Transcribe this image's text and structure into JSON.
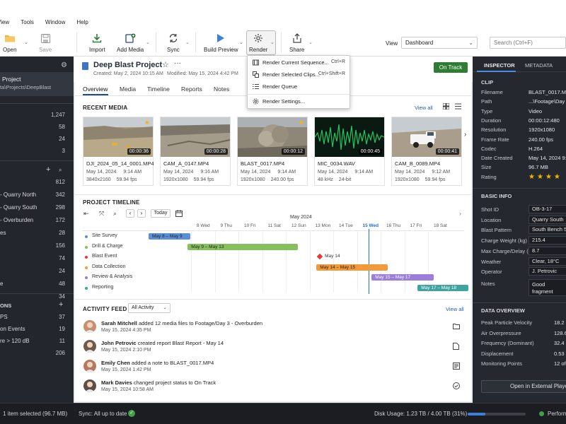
{
  "menu": [
    "View",
    "Tools",
    "Window",
    "Help"
  ],
  "toolbar": {
    "open": "Open",
    "save": "Save",
    "import": "Import",
    "add_media": "Add Media",
    "sync": "Sync",
    "build_preview": "Build Preview",
    "render": "Render",
    "share": "Share",
    "view_label": "View",
    "view_value": "Dashboard",
    "search_placeholder": "Search (Ctrl+F)"
  },
  "render_menu": [
    {
      "label": "Render Current Sequence...",
      "shortcut": "Ctrl+R",
      "icon": "film-icon"
    },
    {
      "label": "Render Selected Clips...",
      "shortcut": "Ctrl+Shift+R",
      "icon": "clips-icon"
    },
    {
      "label": "Render Queue",
      "shortcut": "",
      "icon": "list-icon"
    },
    {
      "label": "Render Settings...",
      "shortcut": "",
      "icon": "gear-icon"
    }
  ],
  "sidebar": {
    "project_name": "Project",
    "project_path": "ta\\Projects\\DeepBlast",
    "counts_top": [
      "1,247",
      "58",
      "24",
      "3"
    ],
    "tags": [
      {
        "label": "",
        "count": "812"
      },
      {
        "label": "- Quarry North",
        "count": "342"
      },
      {
        "label": "- Quarry South",
        "count": "298"
      },
      {
        "label": "- Overburden",
        "count": "172"
      },
      {
        "label": "es",
        "count": "28"
      },
      {
        "label": "",
        "count": "156"
      },
      {
        "label": "",
        "count": "74"
      },
      {
        "label": "",
        "count": "24"
      },
      {
        "label": "e",
        "count": "48"
      },
      {
        "label": "",
        "count": "34"
      }
    ],
    "conditions_title": "ONS",
    "conditions": [
      {
        "label": "PS",
        "count": "37"
      },
      {
        "label": "on Events",
        "count": "19"
      },
      {
        "label": "re > 120 dB",
        "count": "11"
      },
      {
        "label": "",
        "count": "206"
      }
    ]
  },
  "project": {
    "title": "Deep Blast Project",
    "created": "Created: May 2, 2024 10:15 AM",
    "modified": "Modified: May 15, 2024 4:42 PM",
    "status": "On Track"
  },
  "tabs": [
    "Overview",
    "Media",
    "Timeline",
    "Reports",
    "Notes"
  ],
  "recent_media": {
    "title": "RECENT MEDIA",
    "view_all": "View all",
    "items": [
      {
        "name": "DJI_2024_05_14_0001.MP4",
        "date": "May 14, 2024",
        "time": "9:14 AM",
        "res": "3840x2160",
        "fps": "59.94 fps",
        "duration": "00:00:36",
        "starred": true,
        "kind": "quarry"
      },
      {
        "name": "CAM_A_0147.MP4",
        "date": "May 14, 2024",
        "time": "9:16 AM",
        "res": "1920x1080",
        "fps": "59.94 fps",
        "duration": "00:00:28",
        "starred": false,
        "kind": "quarry2"
      },
      {
        "name": "BLAST_0017.MP4",
        "date": "May 14, 2024",
        "time": "9:14 AM",
        "res": "1920x1080",
        "fps": "240.00 fps",
        "duration": "00:00:12",
        "starred": true,
        "kind": "blast"
      },
      {
        "name": "MIC_0034.WAV",
        "date": "May 14, 2024",
        "time": "9:14 AM",
        "res": "48 kHz",
        "fps": "24-bit",
        "duration": "00:00:45",
        "starred": false,
        "kind": "audio"
      },
      {
        "name": "CAM_B_0089.MP4",
        "date": "May 14, 2024",
        "time": "9:12 AM",
        "res": "1920x1080",
        "fps": "59.94 fps",
        "duration": "00:00:41",
        "starred": false,
        "kind": "truck"
      }
    ]
  },
  "timeline": {
    "title": "PROJECT TIMELINE",
    "today": "Today",
    "month": "May 2024",
    "days": [
      "8 Wed",
      "9 Thu",
      "10 Fri",
      "11 Sat",
      "12 Sun",
      "13 Mon",
      "14 Tue",
      "15 Wed",
      "16 Thu",
      "17 Fri",
      "18 Sat"
    ],
    "today_index": 7,
    "tracks": [
      {
        "name": "Site Survey",
        "color": "#5b8fd4",
        "label": "May 8 – May 9",
        "start": 0,
        "end": 1.8
      },
      {
        "name": "Drill & Charge",
        "color": "#86bf5e",
        "label": "May 9 – May 13",
        "start": 1.7,
        "end": 6.5
      },
      {
        "name": "Blast Event",
        "color": "#e53935",
        "label": "May 14",
        "start": 7.45,
        "end": 7.45,
        "milestone": true
      },
      {
        "name": "Data Collection",
        "color": "#f29a3a",
        "label": "May 14 – May 15",
        "start": 7.3,
        "end": 10.4
      },
      {
        "name": "Review & Analysis",
        "color": "#9b7ddc",
        "label": "May 15 – May 17",
        "start": 9.7,
        "end": 12.4
      },
      {
        "name": "Reporting",
        "color": "#3fa3a0",
        "label": "May 17 – May 18",
        "start": 11.7,
        "end": 13.9
      }
    ]
  },
  "activity": {
    "title": "ACTIVITY FEED",
    "filter": "All Activity",
    "view_all": "View all",
    "items": [
      {
        "user": "Sarah Mitchell",
        "action": " added 12 media files to Footage/Day 3 - Overburden",
        "time": "May 15, 2024    4:35 PM",
        "icon": "folder-icon",
        "avatar": "#c98d6f"
      },
      {
        "user": "John Petrovic",
        "action": " created report Blast Report - May 14",
        "time": "May 15, 2024    2:10 PM",
        "icon": "document-icon",
        "avatar": "#6f5a4a"
      },
      {
        "user": "Emily Chen",
        "action": " added a note to BLAST_0017.MP4",
        "time": "May 15, 2024    1:42 PM",
        "icon": "note-icon",
        "avatar": "#b57a5e"
      },
      {
        "user": "Mark Davies",
        "action": " changed project status to On Track",
        "time": "May 15, 2024    10:58 AM",
        "icon": "check-circle-icon",
        "avatar": "#5d4f45"
      }
    ]
  },
  "inspector": {
    "tabs": [
      "INSPECTOR",
      "METADATA"
    ],
    "clip_title": "CLIP",
    "clip": [
      {
        "k": "Filename",
        "v": "BLAST_0017.MP4"
      },
      {
        "k": "Path",
        "v": "...\\Footage\\Day"
      },
      {
        "k": "Type",
        "v": "Video"
      },
      {
        "k": "Duration",
        "v": "00:00:12:480"
      },
      {
        "k": "Resolution",
        "v": "1920x1080"
      },
      {
        "k": "Frame Rate",
        "v": "240.00 fps"
      },
      {
        "k": "Codec",
        "v": "H.264"
      },
      {
        "k": "Date Created",
        "v": "May 14, 2024  9:"
      },
      {
        "k": "Size",
        "v": "96.7 MB"
      },
      {
        "k": "Rating",
        "v": ""
      }
    ],
    "rating": 4,
    "basic_title": "BASIC INFO",
    "basic": [
      {
        "k": "Shot ID",
        "v": "OB-3-17"
      },
      {
        "k": "Location",
        "v": "Quarry South"
      },
      {
        "k": "Blast Pattern",
        "v": "South Bench 5"
      },
      {
        "k": "Charge Weight (kg)",
        "v": "215.4"
      },
      {
        "k": "Max Charge/Delay (kg)",
        "v": "8.7"
      },
      {
        "k": "Weather",
        "v": "Clear, 18°C"
      },
      {
        "k": "Operator",
        "v": "J. Petrovic"
      }
    ],
    "notes_label": "Notes",
    "notes_value": "Good fragment overpressure c",
    "data_title": "DATA OVERVIEW",
    "data": [
      {
        "k": "Peak Particle Velocity",
        "v": "18.2"
      },
      {
        "k": "Air Overpressure",
        "v": "128.6"
      },
      {
        "k": "Frequency (Dominant)",
        "v": "32.4"
      },
      {
        "k": "Displacement",
        "v": "0.53"
      },
      {
        "k": "Monitoring Points",
        "v": "12 of"
      }
    ],
    "open_external": "Open in External Player"
  },
  "status": {
    "selected": "1 item selected (96.7 MB)",
    "sync": "Sync: All up to date",
    "disk": "Disk Usage: 1.23 TB / 4.00 TB (31%)",
    "disk_fraction": 0.31,
    "perf": "Perform"
  },
  "colors": {
    "accent": "#1f4a85",
    "green": "#2e7d32"
  }
}
